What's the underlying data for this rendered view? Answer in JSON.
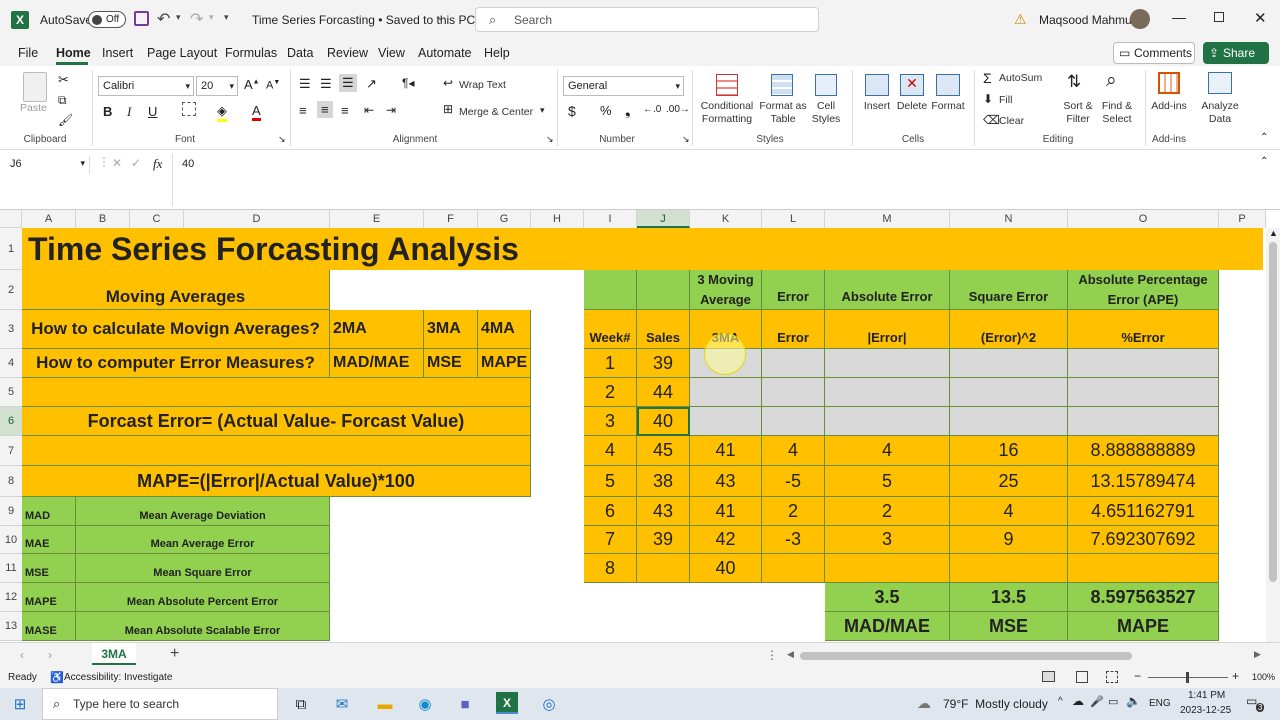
{
  "titlebar": {
    "autosave": "AutoSave",
    "toggle": "Off",
    "doc_title": "Time Series Forcasting • Saved to this PC",
    "search": "Search",
    "user": "Maqsood Mahmud"
  },
  "menu": {
    "items": [
      "File",
      "Home",
      "Insert",
      "Page Layout",
      "Formulas",
      "Data",
      "Review",
      "View",
      "Automate",
      "Help"
    ],
    "comments": "Comments",
    "share": "Share"
  },
  "ribbon": {
    "clipboard": {
      "paste": "Paste",
      "label": "Clipboard"
    },
    "font": {
      "name": "Calibri",
      "size": "20",
      "label": "Font"
    },
    "alignment": {
      "wrap": "Wrap Text",
      "merge": "Merge & Center",
      "label": "Alignment"
    },
    "number": {
      "format": "General",
      "label": "Number"
    },
    "styles": {
      "cond": "Conditional Formatting",
      "table": "Format as Table",
      "cell": "Cell Styles",
      "label": "Styles"
    },
    "cells": {
      "insert": "Insert",
      "delete": "Delete",
      "format": "Format",
      "label": "Cells"
    },
    "editing": {
      "autosum": "AutoSum",
      "fill": "Fill",
      "clear": "Clear",
      "sort": "Sort & Filter",
      "find": "Find & Select",
      "label": "Editing"
    },
    "addins": {
      "addins": "Add-ins",
      "analyze": "Analyze Data",
      "label": "Add-ins"
    }
  },
  "formula_bar": {
    "name_box": "J6",
    "fx": "fx",
    "value": "40"
  },
  "columns": [
    "A",
    "B",
    "C",
    "D",
    "E",
    "F",
    "G",
    "H",
    "I",
    "J",
    "K",
    "L",
    "M",
    "N",
    "O",
    "P"
  ],
  "rows": [
    "1",
    "2",
    "3",
    "4",
    "5",
    "6",
    "7",
    "8",
    "9",
    "10",
    "11",
    "12",
    "13"
  ],
  "sheet": {
    "title": "Time Series Forcasting Analysis",
    "moving_averages": "Moving Averages",
    "how_ma": "How to calculate Movign Averages?",
    "ma2": "2MA",
    "ma3": "3MA",
    "ma4": "4MA",
    "how_err": "How to computer Error Measures?",
    "mad_mae": "MAD/MAE",
    "mse": "MSE",
    "mape": "MAPE",
    "forecast_error": "Forcast Error= (Actual Value- Forcast Value)",
    "mape_formula": "MAPE=(|Error|/Actual Value)*100",
    "measures": [
      {
        "abbr": "MAD",
        "name": "Mean Average Deviation"
      },
      {
        "abbr": "MAE",
        "name": "Mean Average Error"
      },
      {
        "abbr": "MSE",
        "name": "Mean Square Error"
      },
      {
        "abbr": "MAPE",
        "name": "Mean Absolute Percent Error"
      },
      {
        "abbr": "MASE",
        "name": "Mean Absolute Scalable Error"
      }
    ],
    "table_headers_row2": {
      "k": "3 Moving Average",
      "l": "Error",
      "m": "Absolute Error",
      "n": "Square Error",
      "o": "Absolute Percentage Error (APE)"
    },
    "table_headers_row3": {
      "i": "Week#",
      "j": "Sales",
      "k": "3MA",
      "l": "Error",
      "m": "|Error|",
      "n": "(Error)^2",
      "o": "%Error"
    },
    "data_rows": [
      {
        "week": "1",
        "sales": "39",
        "ma": "",
        "err": "",
        "abs": "",
        "sq": "",
        "pct": ""
      },
      {
        "week": "2",
        "sales": "44",
        "ma": "",
        "err": "",
        "abs": "",
        "sq": "",
        "pct": ""
      },
      {
        "week": "3",
        "sales": "40",
        "ma": "",
        "err": "",
        "abs": "",
        "sq": "",
        "pct": ""
      },
      {
        "week": "4",
        "sales": "45",
        "ma": "41",
        "err": "4",
        "abs": "4",
        "sq": "16",
        "pct": "8.888888889"
      },
      {
        "week": "5",
        "sales": "38",
        "ma": "43",
        "err": "-5",
        "abs": "5",
        "sq": "25",
        "pct": "13.15789474"
      },
      {
        "week": "6",
        "sales": "43",
        "ma": "41",
        "err": "2",
        "abs": "2",
        "sq": "4",
        "pct": "4.651162791"
      },
      {
        "week": "7",
        "sales": "39",
        "ma": "42",
        "err": "-3",
        "abs": "3",
        "sq": "9",
        "pct": "7.692307692"
      },
      {
        "week": "8",
        "sales": "",
        "ma": "40",
        "err": "",
        "abs": "",
        "sq": "",
        "pct": ""
      }
    ],
    "summary": {
      "mad": "3.5",
      "mse": "13.5",
      "mape": "8.597563527",
      "mad_label": "MAD/MAE",
      "mse_label": "MSE",
      "mape_label": "MAPE"
    }
  },
  "tabs": {
    "sheet": "3MA",
    "add": "+"
  },
  "status": {
    "ready": "Ready",
    "accessibility": "Accessibility: Investigate",
    "zoom": "100%"
  },
  "taskbar": {
    "search": "Type here to search",
    "weather": "79°F  Mostly cloudy",
    "lang": "ENG",
    "time": "1:41 PM",
    "date": "2023-12-25",
    "notif": "3"
  },
  "colors": {
    "orange": "#ffc000",
    "green": "#92d050",
    "gray": "#d9d9d9",
    "excel_green": "#217346"
  }
}
